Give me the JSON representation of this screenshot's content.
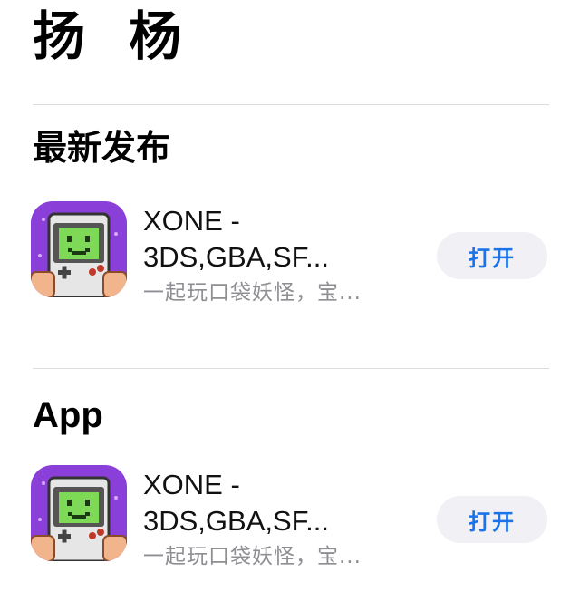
{
  "header": {
    "title": "扬 杨"
  },
  "sections": [
    {
      "title": "最新发布",
      "app": {
        "name_line1": "XONE -",
        "name_line2": "3DS,GBA,SF...",
        "subtitle": "一起玩口袋妖怪，宝...",
        "button_label": "打开",
        "icon": "gameboy-face-icon"
      }
    },
    {
      "title": "App",
      "app": {
        "name_line1": "XONE -",
        "name_line2": "3DS,GBA,SF...",
        "subtitle": "一起玩口袋妖怪，宝...",
        "button_label": "打开",
        "icon": "gameboy-face-icon"
      }
    }
  ],
  "colors": {
    "accent": "#1a73e8",
    "icon_background": "#8b3fd9",
    "screen_green": "#7ed957",
    "button_background": "#f0f0f5",
    "subtitle_gray": "#8e8e93"
  }
}
